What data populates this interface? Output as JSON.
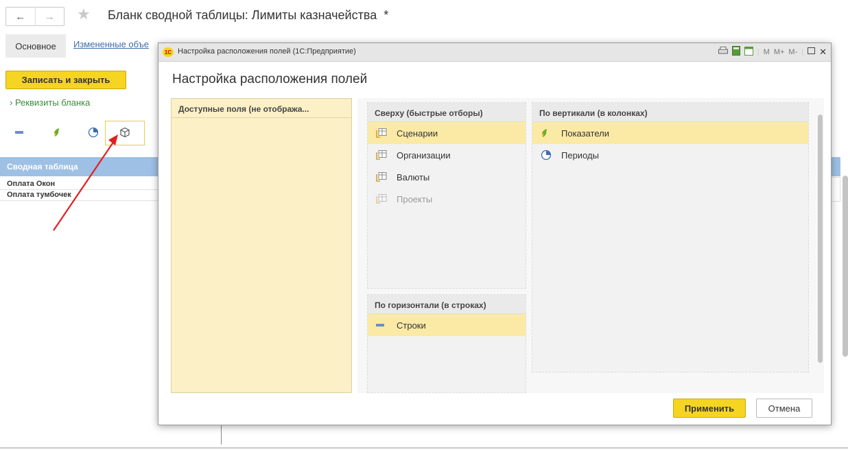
{
  "window": {
    "title": "Бланк сводной таблицы: Лимиты казначейства",
    "modified_mark": "*"
  },
  "nav": {
    "back_icon": "arrow-left-icon",
    "forward_icon": "arrow-right-icon",
    "favorite_icon": "star-icon"
  },
  "tabs": [
    {
      "label": "Основное",
      "active": true
    },
    {
      "label": "Измененные объе",
      "active": false
    }
  ],
  "toolbar": {
    "save_close_label": "Записать и закрыть"
  },
  "requisites": {
    "label": "Реквизиты бланка"
  },
  "field_tools": [
    {
      "icon": "rows-icon"
    },
    {
      "icon": "indicator-icon"
    },
    {
      "icon": "period-icon"
    },
    {
      "icon": "cube-icon",
      "selected": true
    }
  ],
  "grid": {
    "header": "Сводная таблица",
    "rows": [
      "Оплата Окон",
      "Оплата тумбочек"
    ]
  },
  "dialog": {
    "title": "Настройка расположения полей  (1С:Предприятие)",
    "logo_text": "1С",
    "titlebar_buttons": [
      "print-icon",
      "calculator-icon",
      "calendar-icon",
      "M",
      "M+",
      "M-",
      "maximize-icon",
      "close-icon"
    ],
    "header": "Настройка расположения полей",
    "available": {
      "title": "Доступные поля (не отобража..."
    },
    "top_filters": {
      "title": "Сверху (быстрые отборы)",
      "items": [
        {
          "label": "Сценарии",
          "selected": true,
          "enabled": true
        },
        {
          "label": "Организации",
          "selected": false,
          "enabled": true
        },
        {
          "label": "Валюты",
          "selected": false,
          "enabled": true
        },
        {
          "label": "Проекты",
          "selected": false,
          "enabled": false
        }
      ]
    },
    "horizontal": {
      "title": "По горизонтали (в строках)",
      "items": [
        {
          "label": "Строки",
          "selected": true
        }
      ]
    },
    "vertical": {
      "title": "По вертикали (в колонках)",
      "items": [
        {
          "label": "Показатели",
          "selected": true
        },
        {
          "label": "Периоды",
          "selected": false
        }
      ]
    },
    "apply_label": "Применить",
    "cancel_label": "Отмена"
  },
  "colors": {
    "accent_yellow": "#f5d521",
    "selection": "#fbeaa6",
    "link": "#3d6ea8",
    "grid_header": "#9ec0e4",
    "annotation_arrow": "#e02020"
  }
}
